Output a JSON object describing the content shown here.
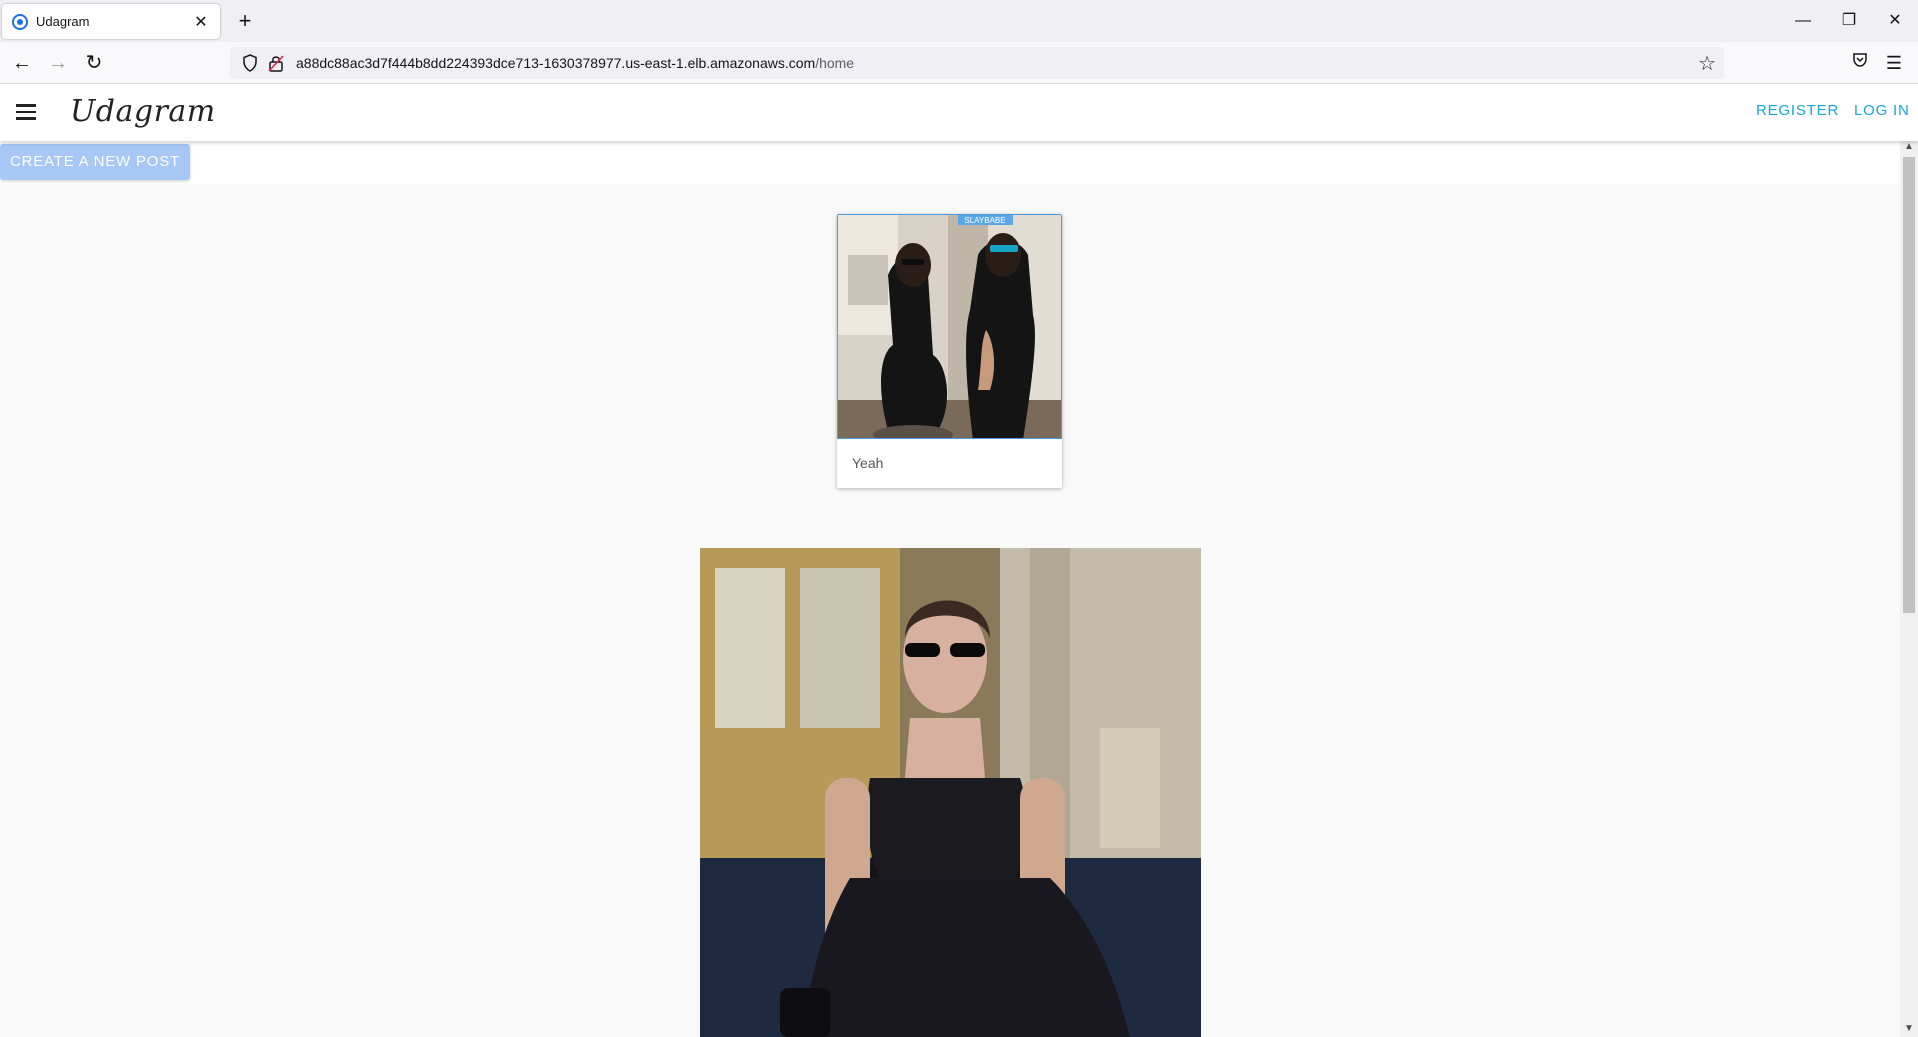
{
  "browser": {
    "tab_title": "Udagram",
    "url_host": "a88dc88ac3d7f444b8dd224393dce713-1630378977.us-east-1.elb.amazonaws.com",
    "url_path": "/home",
    "icons": {
      "back": "back-arrow-icon",
      "forward": "forward-arrow-icon",
      "reload": "reload-icon",
      "bookmark": "star-icon",
      "pocket": "pocket-icon",
      "menu": "hamburger-menu-icon"
    }
  },
  "app": {
    "brand": "Udagram",
    "register_label": "REGISTER",
    "login_label": "LOG IN",
    "create_post_label": "CREATE A NEW POST"
  },
  "feed": {
    "posts": [
      {
        "caption": "Yeah",
        "image_badge": "SLAYBABE"
      },
      {
        "caption": ""
      }
    ]
  },
  "colors": {
    "accent_link": "#17a6d8",
    "create_button": "#a7c7f5",
    "page_background": "#f9f9fa"
  }
}
